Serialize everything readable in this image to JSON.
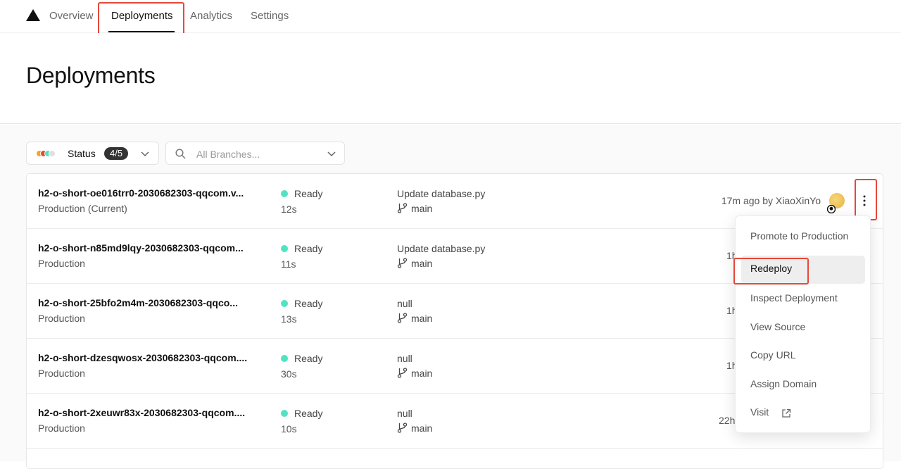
{
  "nav": {
    "tabs": [
      {
        "label": "Overview"
      },
      {
        "label": "Deployments"
      },
      {
        "label": "Analytics"
      },
      {
        "label": "Settings"
      }
    ],
    "active_tab": "Deployments"
  },
  "page": {
    "title": "Deployments"
  },
  "filters": {
    "status_label": "Status",
    "status_count": "4/5",
    "branch_placeholder": "All Branches..."
  },
  "deployments": [
    {
      "name": "h2-o-short-oe016trr0-2030682303-qqcom.v...",
      "env": "Production (Current)",
      "state": "Ready",
      "duration": "12s",
      "commit": "Update database.py",
      "branch": "main",
      "time": "17m ago by XiaoXinYo"
    },
    {
      "name": "h2-o-short-n85md9lqy-2030682303-qqcom...",
      "env": "Production",
      "state": "Ready",
      "duration": "11s",
      "commit": "Update database.py",
      "branch": "main",
      "time": "1h"
    },
    {
      "name": "h2-o-short-25bfo2m4m-2030682303-qqco...",
      "env": "Production",
      "state": "Ready",
      "duration": "13s",
      "commit": "null",
      "branch": "main",
      "time": "1h"
    },
    {
      "name": "h2-o-short-dzesqwosx-2030682303-qqcom....",
      "env": "Production",
      "state": "Ready",
      "duration": "30s",
      "commit": "null",
      "branch": "main",
      "time": "1h"
    },
    {
      "name": "h2-o-short-2xeuwr83x-2030682303-qqcom....",
      "env": "Production",
      "state": "Ready",
      "duration": "10s",
      "commit": "null",
      "branch": "main",
      "time": "22h"
    }
  ],
  "menu": {
    "items": [
      {
        "label": "Promote to Production"
      },
      {
        "label": "Redeploy"
      },
      {
        "label": "Inspect Deployment"
      },
      {
        "label": "View Source"
      },
      {
        "label": "Copy URL"
      },
      {
        "label": "Assign Domain"
      },
      {
        "label": "Visit"
      }
    ],
    "active_item": "Redeploy"
  },
  "colors": {
    "ready": "#50e3c2",
    "highlight": "#e5483a",
    "status_dots": [
      "#f5a623",
      "#e5483a",
      "#50e3c2",
      "#cccccc"
    ]
  }
}
